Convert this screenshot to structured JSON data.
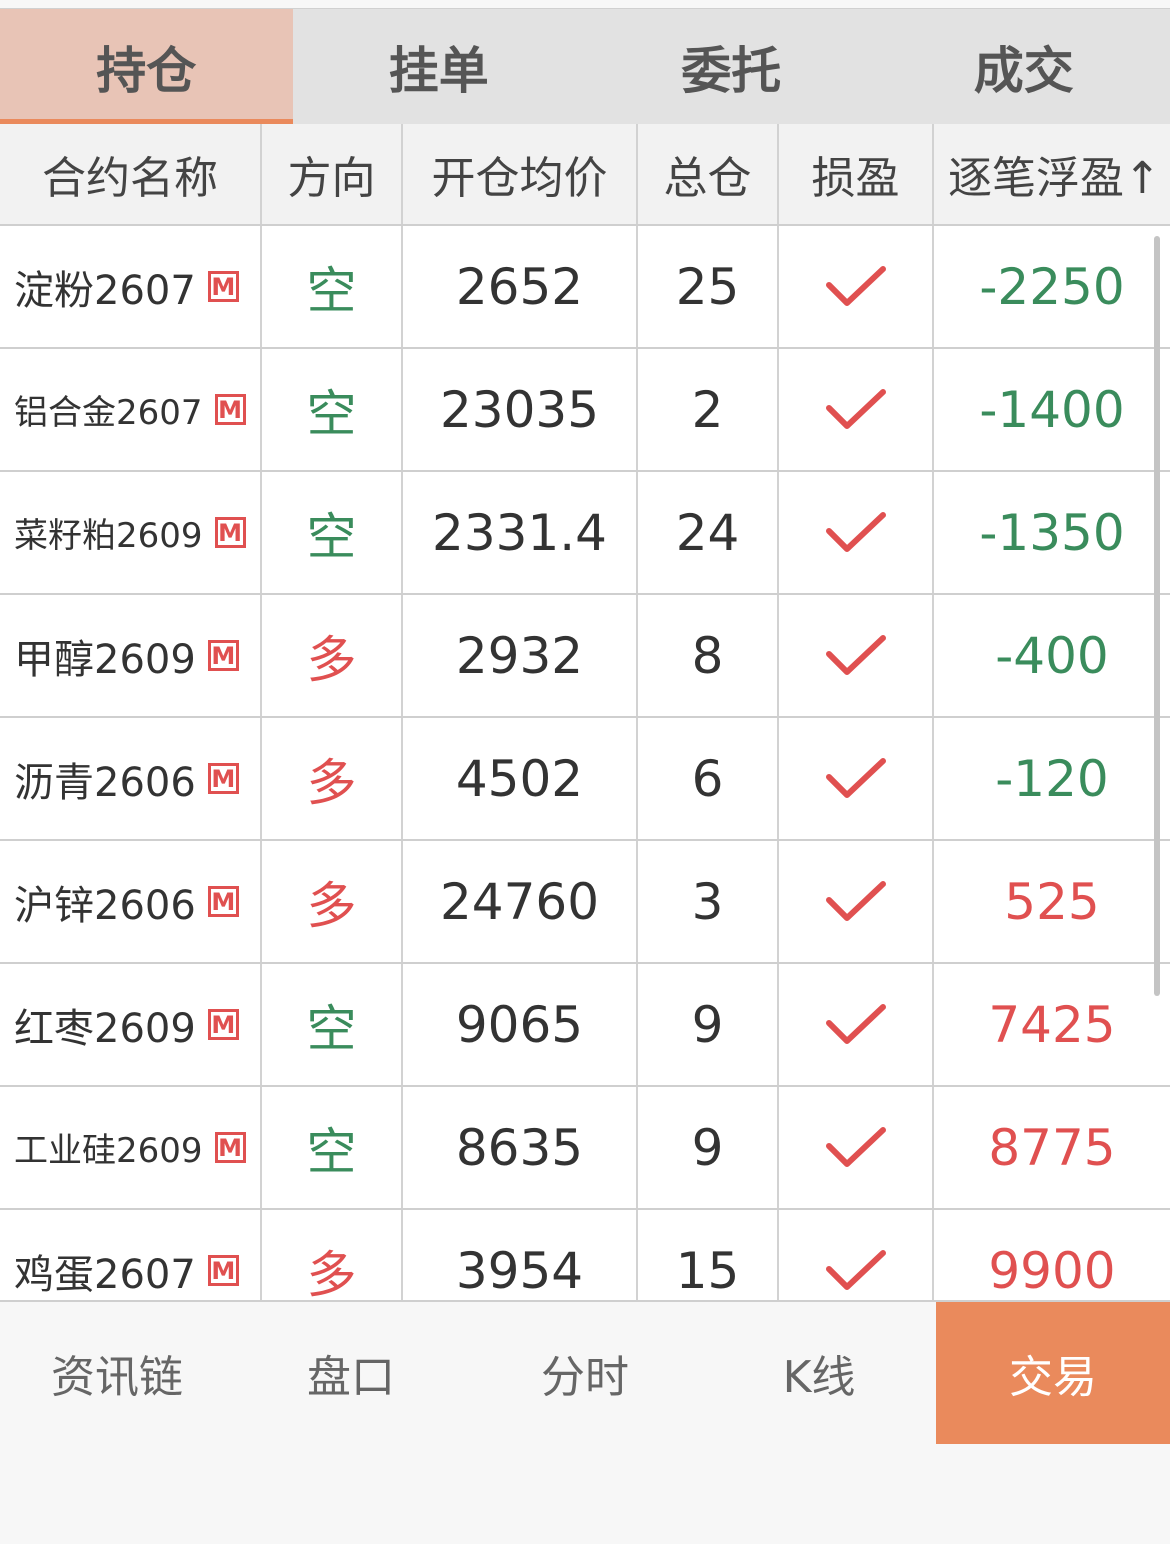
{
  "tabs": [
    {
      "label": "持仓",
      "active": true
    },
    {
      "label": "挂单",
      "active": false
    },
    {
      "label": "委托",
      "active": false
    },
    {
      "label": "成交",
      "active": false
    }
  ],
  "columns": [
    "合约名称",
    "方向",
    "开仓均价",
    "总仓",
    "损盈",
    "逐笔浮盈↑"
  ],
  "rows": [
    {
      "name": "淀粉2607",
      "badge": "M",
      "direction": "空",
      "avg_price": "2652",
      "total": "25",
      "stop": "check-icon",
      "pnl": "-2250"
    },
    {
      "name": "铝合金2607",
      "badge": "M",
      "direction": "空",
      "avg_price": "23035",
      "total": "2",
      "stop": "check-icon",
      "pnl": "-1400"
    },
    {
      "name": "菜籽粕2609",
      "badge": "M",
      "direction": "空",
      "avg_price": "2331.4",
      "total": "24",
      "stop": "check-icon",
      "pnl": "-1350"
    },
    {
      "name": "甲醇2609",
      "badge": "M",
      "direction": "多",
      "avg_price": "2932",
      "total": "8",
      "stop": "check-icon",
      "pnl": "-400"
    },
    {
      "name": "沥青2606",
      "badge": "M",
      "direction": "多",
      "avg_price": "4502",
      "total": "6",
      "stop": "check-icon",
      "pnl": "-120"
    },
    {
      "name": "沪锌2606",
      "badge": "M",
      "direction": "多",
      "avg_price": "24760",
      "total": "3",
      "stop": "check-icon",
      "pnl": "525"
    },
    {
      "name": "红枣2609",
      "badge": "M",
      "direction": "空",
      "avg_price": "9065",
      "total": "9",
      "stop": "check-icon",
      "pnl": "7425"
    },
    {
      "name": "工业硅2609",
      "badge": "M",
      "direction": "空",
      "avg_price": "8635",
      "total": "9",
      "stop": "check-icon",
      "pnl": "8775"
    },
    {
      "name": "鸡蛋2607",
      "badge": "M",
      "direction": "多",
      "avg_price": "3954",
      "total": "15",
      "stop": "check-icon",
      "pnl": "9900"
    }
  ],
  "bottom_nav": [
    {
      "label": "资讯链",
      "active": false
    },
    {
      "label": "盘口",
      "active": false
    },
    {
      "label": "分时",
      "active": false
    },
    {
      "label": "K线",
      "active": false
    },
    {
      "label": "交易",
      "active": true
    }
  ],
  "colors": {
    "accent": "#ea8a5c",
    "tab_active_bg": "#e8c4b6",
    "short_green": "#3a8c5c",
    "long_red": "#e05050"
  }
}
